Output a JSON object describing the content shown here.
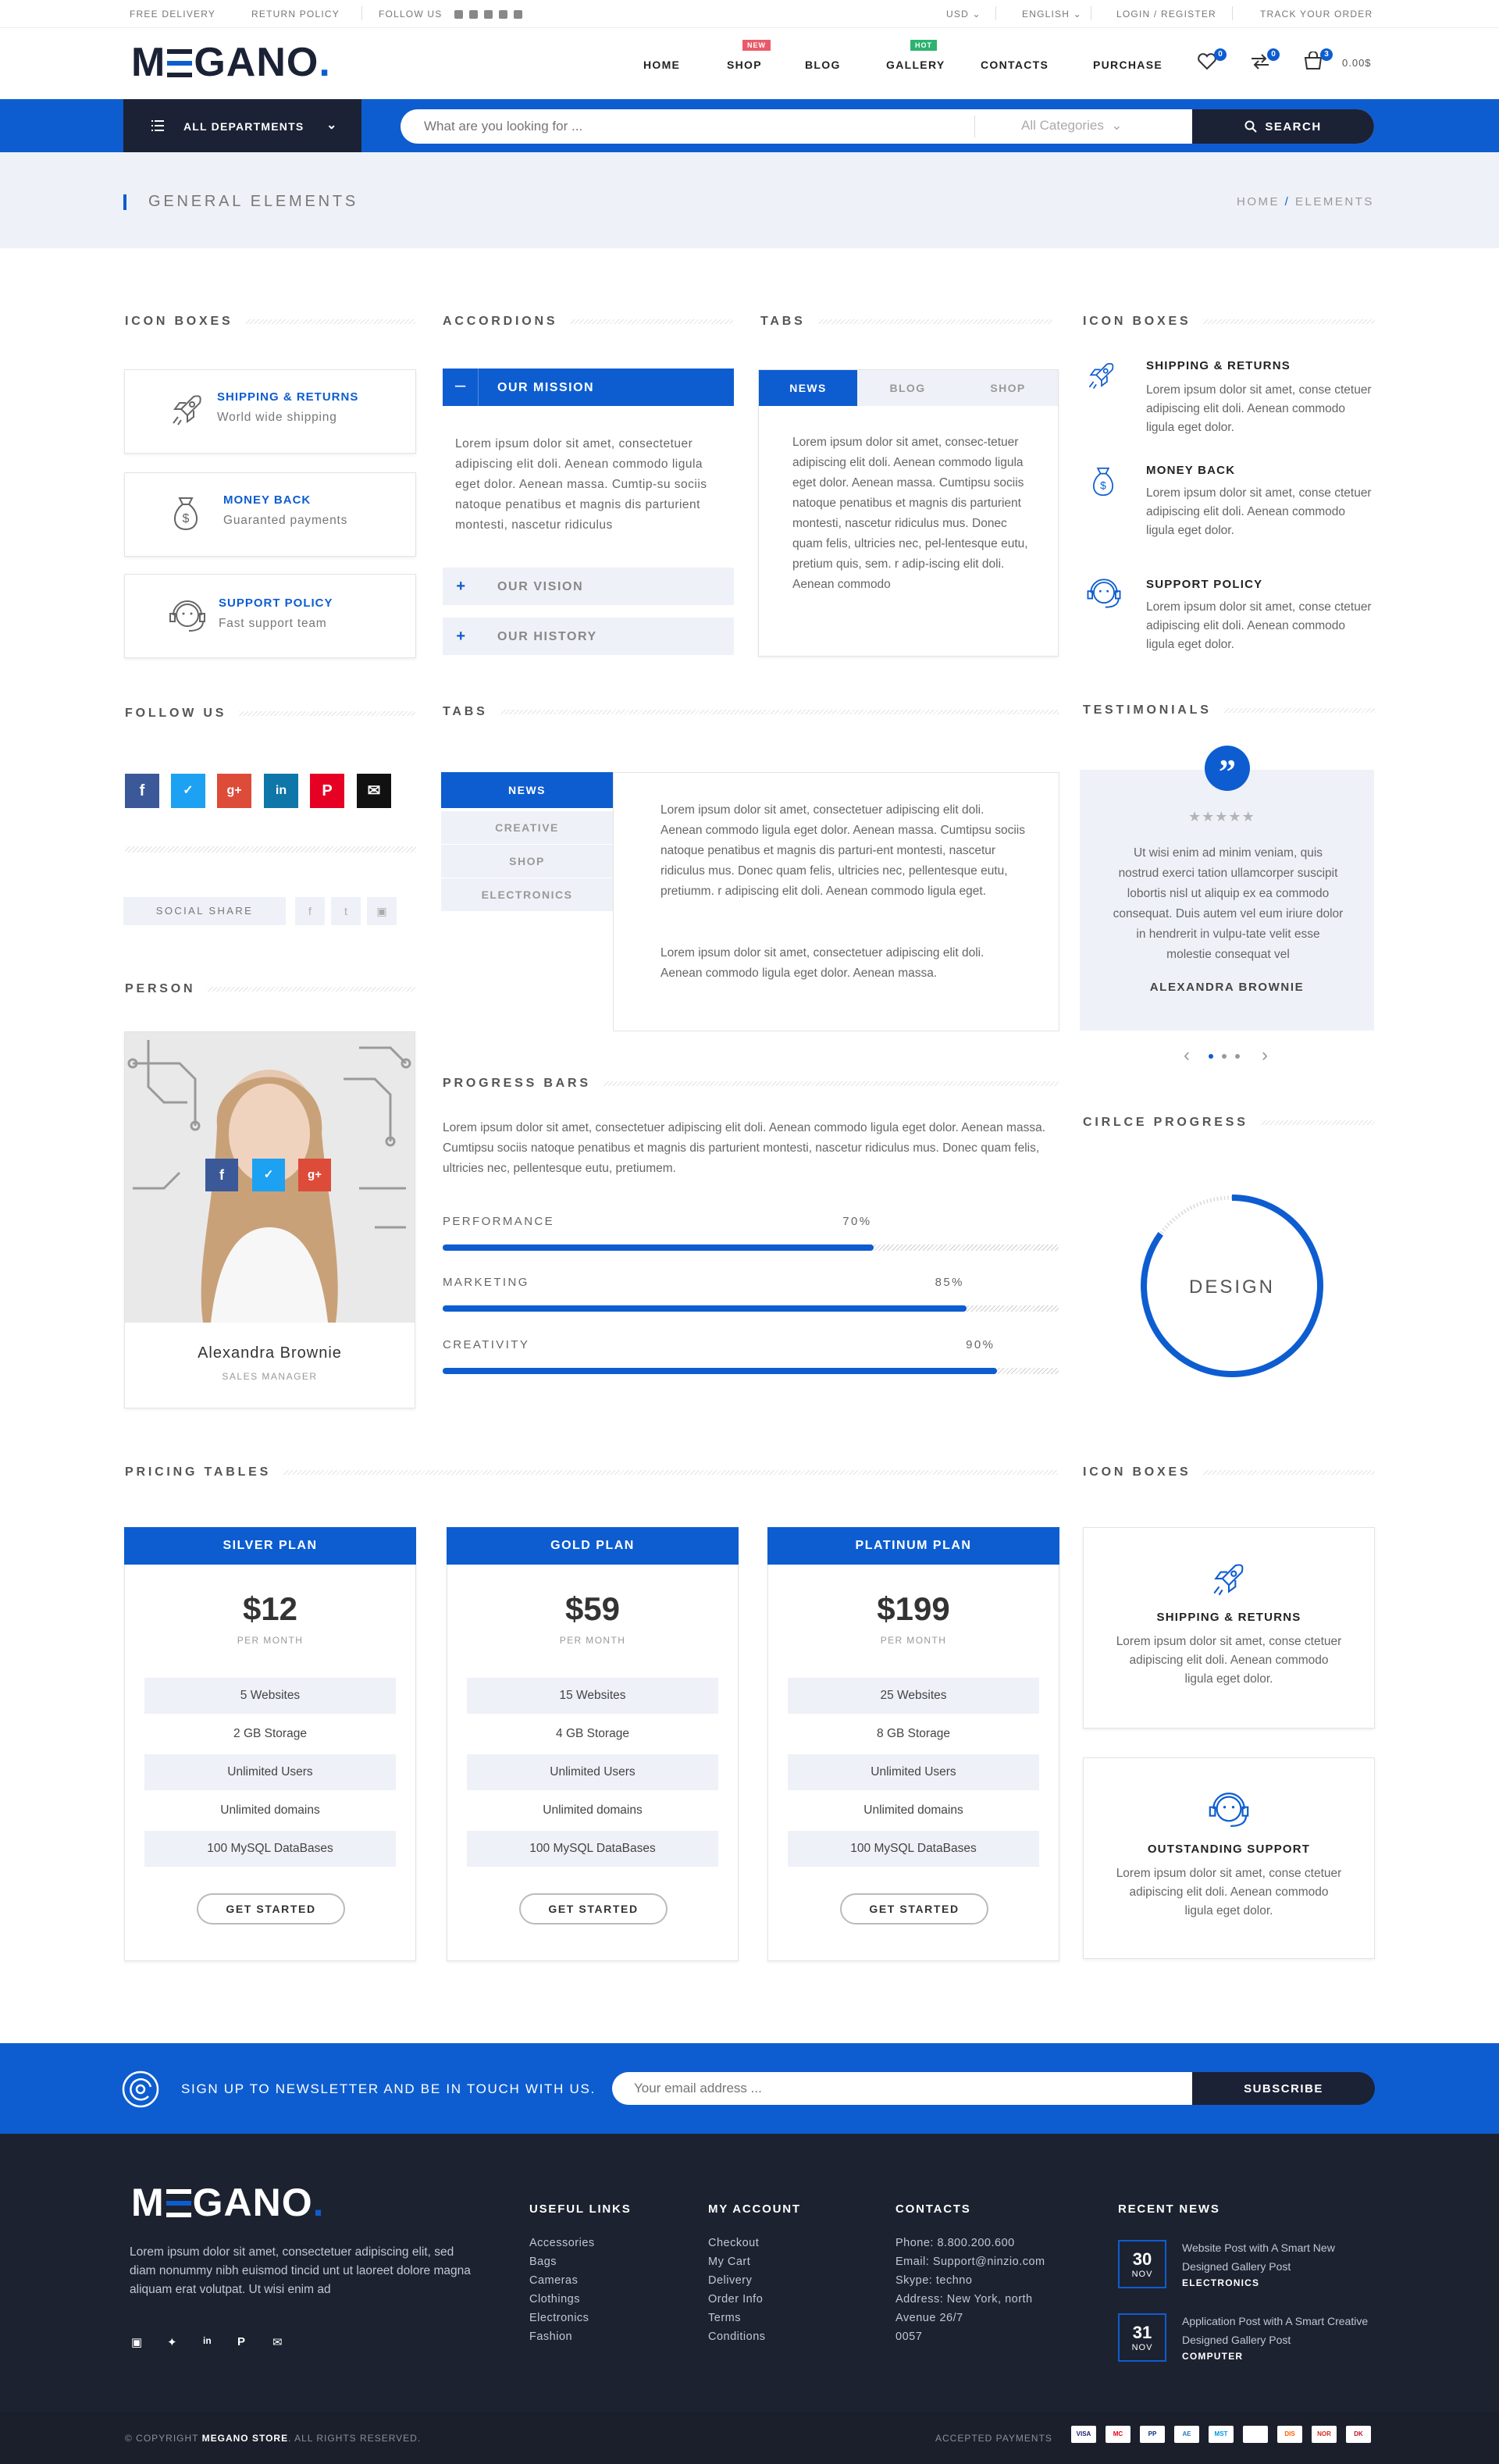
{
  "topbar": {
    "free_delivery": "FREE DELIVERY",
    "return_policy": "RETURN POLICY",
    "follow_us": "FOLLOW US",
    "currency": "USD",
    "language": "ENGLISH",
    "login": "LOGIN",
    "register": "REGISTER",
    "login_sep": "/",
    "track": "TRACK YOUR ORDER"
  },
  "header": {
    "logo_pre": "M",
    "logo_post": "GANO",
    "logo_dot": ".",
    "nav": [
      "HOME",
      "SHOP",
      "BLOG",
      "GALLERY",
      "CONTACTS",
      "PURCHASE"
    ],
    "badge_new": "NEW",
    "badge_hot": "HOT",
    "wishlist_count": "0",
    "compare_count": "0",
    "cart_count": "3",
    "cart_total": "0.00$"
  },
  "searchbar": {
    "departments": "ALL DEPARTMENTS",
    "placeholder": "What are you looking for ...",
    "category": "All Categories",
    "button": "SEARCH"
  },
  "pagetitle": {
    "title": "GENERAL ELEMENTS",
    "crumb_home": "HOME",
    "crumb_sep": "/",
    "crumb_current": "ELEMENTS"
  },
  "sections": {
    "icon_boxes": "ICON BOXES",
    "accordions": "ACCORDIONS",
    "tabs": "TABS",
    "follow_us": "FOLLOW US",
    "testimonials": "TESTIMONIALS",
    "person": "PERSON",
    "progress_bars": "PROGRESS BARS",
    "circle_progress": "CIRLCE PROGRESS",
    "pricing_tables": "PRICING TABLES"
  },
  "iconboxes_left": [
    {
      "title": "SHIPPING & RETURNS",
      "sub": "World wide shipping",
      "icon": "rocket-icon"
    },
    {
      "title": "MONEY BACK",
      "sub": "Guaranted payments",
      "icon": "money-bag-icon"
    },
    {
      "title": "SUPPORT POLICY",
      "sub": "Fast support team",
      "icon": "headset-icon"
    }
  ],
  "accordion": {
    "open_title": "OUR MISSION",
    "open_text": "Lorem ipsum dolor sit amet, consectetuer adipiscing elit doli. Aenean commodo ligula eget dolor. Aenean massa. Cumtip-su sociis natoque penatibus et magnis dis parturient montesti, nascetur ridiculus",
    "closed": [
      "OUR VISION",
      "OUR HISTORY"
    ]
  },
  "tabs1": {
    "labels": [
      "NEWS",
      "BLOG",
      "SHOP"
    ],
    "text": "Lorem ipsum dolor sit amet, consec-tetuer adipiscing elit doli. Aenean commodo ligula eget dolor. Aenean massa. Cumtipsu sociis natoque penatibus et magnis dis parturient montesti, nascetur ridiculus mus. Donec quam felis, ultricies nec, pel-lentesque eutu, pretium quis, sem. r adip-iscing elit doli. Aenean commodo"
  },
  "iconboxes_right": [
    {
      "title": "SHIPPING & RETURNS",
      "text": "Lorem ipsum dolor sit amet, conse ctetuer adipiscing elit doli. Aenean commodo ligula eget dolor.",
      "icon": "rocket-icon"
    },
    {
      "title": "MONEY BACK",
      "text": "Lorem ipsum dolor sit amet, conse ctetuer adipiscing elit doli. Aenean commodo ligula eget dolor.",
      "icon": "money-bag-icon"
    },
    {
      "title": "SUPPORT POLICY",
      "text": "Lorem ipsum dolor sit amet, conse ctetuer adipiscing elit doli. Aenean commodo ligula eget dolor.",
      "icon": "headset-icon"
    }
  ],
  "social": {
    "share_label": "SOCIAL SHARE",
    "colors": {
      "facebook": "#3b5998",
      "twitter": "#1da1f2",
      "gplus": "#dd4b39",
      "linkedin": "#0e76a8",
      "pinterest": "#e60023",
      "email": "#111111"
    }
  },
  "tabs2": {
    "labels": [
      "NEWS",
      "CREATIVE",
      "SHOP",
      "ELECTRONICS"
    ],
    "p1": "Lorem ipsum dolor sit amet, consectetuer adipiscing elit doli. Aenean commodo ligula eget dolor. Aenean massa. Cumtipsu sociis natoque penatibus et magnis dis parturi-ent montesti, nascetur ridiculus mus. Donec quam felis, ultricies nec, pellentesque eutu, pretiumm. r adipiscing elit doli. Aenean commodo ligula eget.",
    "p2": "Lorem ipsum dolor sit amet, consectetuer adipiscing elit doli. Aenean commodo ligula eget dolor. Aenean massa."
  },
  "testimonial": {
    "quote_mark": "”",
    "stars": 5,
    "text": "Ut wisi enim ad minim veniam, quis nostrud exerci tation ullamcorper suscipit lobortis nisl ut aliquip ex ea commodo consequat. Duis autem vel eum iriure dolor in hendrerit in vulpu-tate velit esse molestie consequat vel",
    "name": "ALEXANDRA BROWNIE",
    "prev": "‹",
    "next": "›"
  },
  "person": {
    "name": "Alexandra Brownie",
    "role": "SALES MANAGER"
  },
  "progress": {
    "intro": "Lorem ipsum dolor sit amet, consectetuer adipiscing elit doli. Aenean commodo ligula eget dolor. Aenean massa. Cumtipsu sociis natoque penatibus et magnis dis parturient montesti, nascetur ridiculus mus. Donec quam felis, ultricies nec, pellentesque eutu, pretiumem.",
    "bars": [
      {
        "label": "PERFORMANCE",
        "pct": "70%",
        "value": 0.7
      },
      {
        "label": "MARKETING",
        "pct": "85%",
        "value": 0.85
      },
      {
        "label": "CREATIVITY",
        "pct": "90%",
        "value": 0.9
      }
    ]
  },
  "circle": {
    "label": "DESIGN",
    "value": 0.85
  },
  "pricing": [
    {
      "name": "SILVER PLAN",
      "price": "$12",
      "per": "PER MONTH",
      "features": [
        "5 Websites",
        "2 GB Storage",
        "Unlimited Users",
        "Unlimited domains",
        "100 MySQL DataBases"
      ],
      "button": "GET STARTED"
    },
    {
      "name": "GOLD PLAN",
      "price": "$59",
      "per": "PER MONTH",
      "features": [
        "15 Websites",
        "4 GB Storage",
        "Unlimited Users",
        "Unlimited domains",
        "100 MySQL DataBases"
      ],
      "button": "GET STARTED"
    },
    {
      "name": "PLATINUM PLAN",
      "price": "$199",
      "per": "PER MONTH",
      "features": [
        "25 Websites",
        "8 GB Storage",
        "Unlimited Users",
        "Unlimited domains",
        "100 MySQL DataBases"
      ],
      "button": "GET STARTED"
    }
  ],
  "iconboxes_bottom": [
    {
      "title": "SHIPPING & RETURNS",
      "text": "Lorem ipsum dolor sit amet, conse ctetuer adipiscing elit doli. Aenean commodo ligula eget dolor.",
      "icon": "rocket-icon"
    },
    {
      "title": "OUTSTANDING SUPPORT",
      "text": "Lorem ipsum dolor sit amet, conse ctetuer adipiscing elit doli. Aenean commodo ligula eget dolor.",
      "icon": "headset-icon"
    }
  ],
  "newsletter": {
    "label": "SIGN UP TO NEWSLETTER AND BE IN TOUCH WITH US.",
    "placeholder": "Your email address ...",
    "button": "SUBSCRIBE"
  },
  "footer": {
    "about": "Lorem ipsum dolor sit amet, consectetuer adipiscing elit, sed diam nonummy nibh euismod tincid  unt ut laoreet dolore magna aliquam erat volutpat. Ut wisi enim ad",
    "useful_title": "USEFUL LINKS",
    "useful": [
      "Accessories",
      "Bags",
      "Cameras",
      "Clothings",
      "Electronics",
      "Fashion"
    ],
    "account_title": "MY ACCOUNT",
    "account": [
      "Checkout",
      "My Cart",
      "Delivery",
      "Order Info",
      "Terms",
      "Conditions"
    ],
    "contacts_title": "CONTACTS",
    "contacts": [
      "Phone: 8.800.200.600",
      "Email: Support@ninzio.com",
      "Skype: techno",
      "Address: New York, north",
      "Avenue 26/7",
      "0057"
    ],
    "news_title": "RECENT NEWS",
    "news": [
      {
        "day": "30",
        "mon": "NOV",
        "title": "Website Post with A Smart New Designed Gallery Post",
        "cat": "ELECTRONICS"
      },
      {
        "day": "31",
        "mon": "NOV",
        "title": "Application Post with A Smart Creative Designed Gallery Post",
        "cat": "COMPUTER"
      }
    ],
    "copyright_pre": "© COPYRIGHT ",
    "copyright_brand": "MEGANO STORE",
    "copyright_post": ". ALL RIGHTS RESERVED.",
    "accepted": "ACCEPTED PAYMENTS",
    "payments": [
      "VISA",
      "MC",
      "PP",
      "AE",
      "MST",
      "PAY",
      "DIS",
      "NOR",
      "DK"
    ]
  },
  "colors": {
    "accent": "#0d5dd1",
    "dark": "#1b2235",
    "light_bg": "#eef1f7"
  }
}
